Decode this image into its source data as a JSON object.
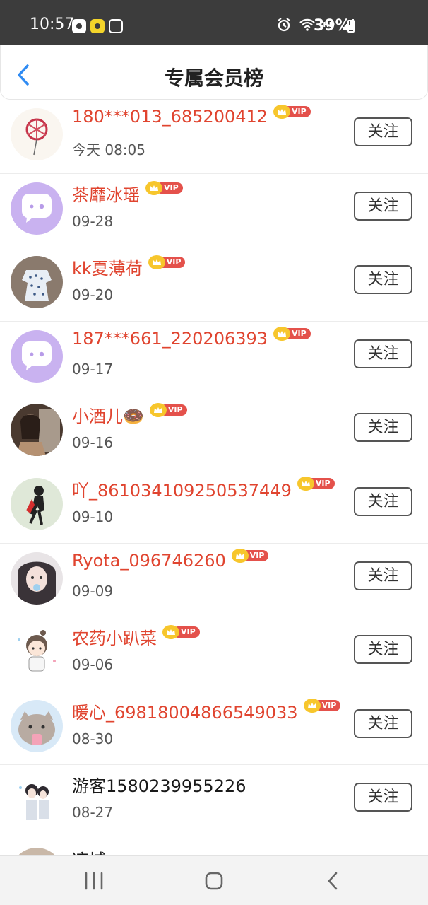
{
  "status_bar": {
    "time": "10:57",
    "network": "HD",
    "battery": "39%"
  },
  "header": {
    "title": "专属会员榜",
    "back_icon": "chevron-left-icon"
  },
  "badge": {
    "vip_label": "VIP"
  },
  "follow_label": "关注",
  "members": [
    {
      "name": "180***013_685200412",
      "date": "今天 08:05",
      "vip": true
    },
    {
      "name": "茶靡冰瑶",
      "date": "09-28",
      "vip": true
    },
    {
      "name": "kk夏薄荷",
      "date": "09-20",
      "vip": true
    },
    {
      "name": "187***661_220206393",
      "date": "09-17",
      "vip": true
    },
    {
      "name": "小酒儿🍩",
      "date": "09-16",
      "vip": true
    },
    {
      "name": "吖_861034109250537449",
      "date": "09-10",
      "vip": true
    },
    {
      "name": "Ryota_096746260",
      "date": "09-09",
      "vip": true
    },
    {
      "name": "农药小趴菜",
      "date": "09-06",
      "vip": true
    },
    {
      "name": "暖心_69818004866549033",
      "date": "08-30",
      "vip": true
    },
    {
      "name": "游客1580239955226",
      "date": "08-27",
      "vip": false
    },
    {
      "name": "凉城",
      "date": "",
      "vip": false
    }
  ],
  "colors": {
    "vip_name": "#e0442f",
    "vip_tag": "#e4514b",
    "crown": "#f7c62c",
    "back_arrow": "#2f8bf3",
    "status_bar": "#3c3c3c"
  },
  "nav": {
    "recents_icon": "recents-icon",
    "home_icon": "home-icon",
    "back_icon": "back-icon"
  }
}
